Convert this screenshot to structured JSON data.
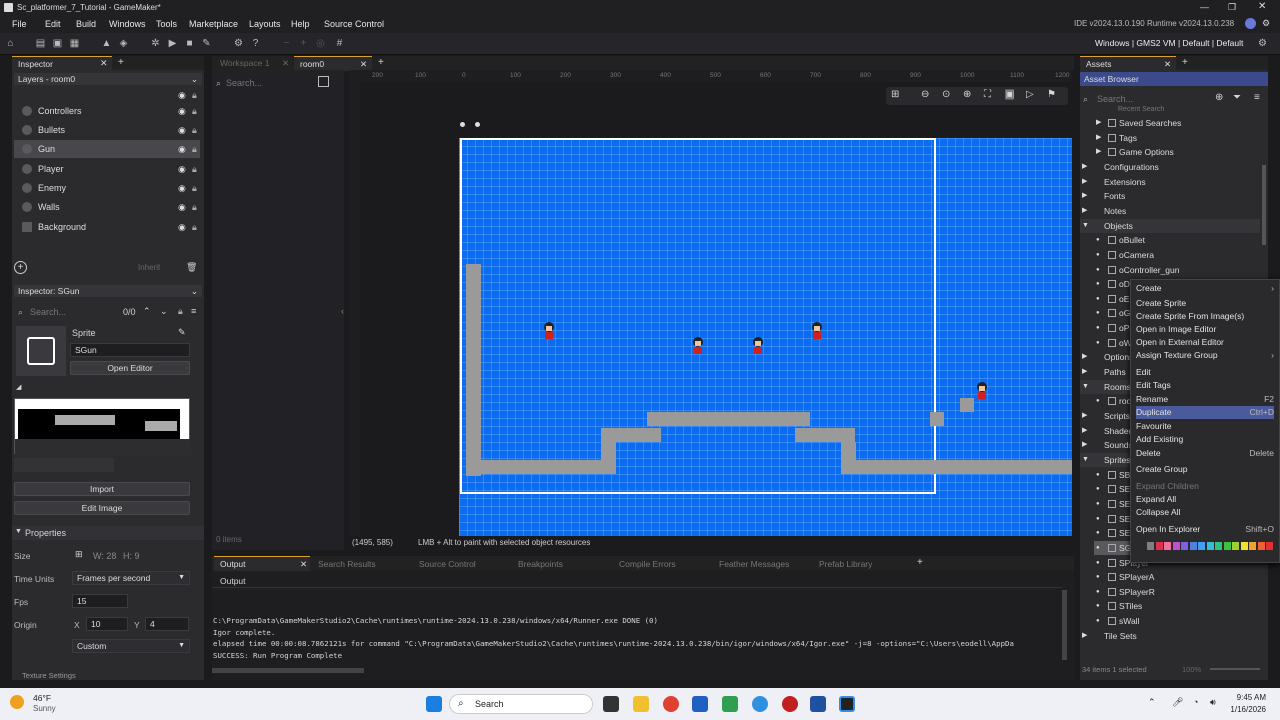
{
  "window": {
    "title": "Sc_platformer_7_Tutorial - GameMaker*",
    "ide_version": "IDE v2024.13.0.190  Runtime v2024.13.0.238"
  },
  "menu": [
    "File",
    "Edit",
    "Build",
    "Windows",
    "Tools",
    "Marketplace",
    "Layouts",
    "Help",
    "Source Control"
  ],
  "target": {
    "label": "Windows | GMS2 VM | Default | Default"
  },
  "inspector": {
    "tab": "Inspector",
    "layers_title": "Layers - room0",
    "layers": [
      "Controllers",
      "Bullets",
      "Gun",
      "Player",
      "Enemy",
      "Walls",
      "Background"
    ],
    "inherit": "Inherit",
    "sub_title": "Inspector: SGun",
    "search_placeholder": "Search...",
    "count": "0/0",
    "sprite_label": "Sprite",
    "sprite_name": "SGun",
    "open_editor": "Open Editor",
    "import": "Import",
    "edit_image": "Edit Image",
    "properties": "Properties",
    "size_label": "Size",
    "size_w": "W: 28",
    "size_h": "H: 9",
    "time_units_label": "Time Units",
    "time_units": "Frames per second",
    "fps_label": "Fps",
    "fps": "15",
    "origin_label": "Origin",
    "origin_x_label": "X",
    "origin_x": "10",
    "origin_y_label": "Y",
    "origin_y": "4",
    "origin_mode": "Custom",
    "texture_settings": "Texture Settings"
  },
  "workspace": {
    "tabs": [
      "Workspace 1",
      "room0"
    ],
    "search_placeholder": "Search...",
    "items_count": "0 items",
    "ruler_marks": [
      "200",
      "100",
      "0",
      "100",
      "200",
      "300",
      "400",
      "500",
      "600",
      "700",
      "800",
      "900",
      "1000",
      "1100",
      "1200"
    ],
    "status_coords": "(1495, 585)",
    "status_hint": "LMB + Alt to paint with selected object resources"
  },
  "output": {
    "tabs": [
      "Output",
      "Search Results",
      "Source Control",
      "Breakpoints",
      "Compile Errors",
      "Feather Messages",
      "Prefab Library"
    ],
    "heading": "Output",
    "lines": [
      "C:\\ProgramData\\GameMakerStudio2\\Cache\\runtimes\\runtime-2024.13.0.238/windows/x64/Runner.exe DONE (0)",
      "Igor complete.",
      "elapsed time 00:00:08.7862121s for command \"C:\\ProgramData\\GameMakerStudio2\\Cache\\runtimes\\runtime-2024.13.0.238/bin/igor/windows/x64/Igor.exe\" -j=8  -options=\"C:\\Users\\eodell\\AppDa",
      "SUCCESS: Run Program Complete"
    ]
  },
  "assets": {
    "tab": "Assets",
    "browser_title": "Asset Browser",
    "search_placeholder": "Search...",
    "partial_top": "Recent Search",
    "items": [
      {
        "label": "Saved Searches",
        "level": 1
      },
      {
        "label": "Tags",
        "level": 1
      },
      {
        "label": "Game Options",
        "level": 1
      },
      {
        "label": "Configurations",
        "level": 0
      },
      {
        "label": "Extensions",
        "level": 0
      },
      {
        "label": "Fonts",
        "level": 0
      },
      {
        "label": "Notes",
        "level": 0
      },
      {
        "label": "Objects",
        "level": 0
      },
      {
        "label": "oBullet",
        "level": 1
      },
      {
        "label": "oCamera",
        "level": 1
      },
      {
        "label": "oController_gun",
        "level": 1
      },
      {
        "label": "oDe",
        "level": 1
      },
      {
        "label": "oEn",
        "level": 1
      },
      {
        "label": "oGu",
        "level": 1
      },
      {
        "label": "oPla",
        "level": 1
      },
      {
        "label": "oWa",
        "level": 1
      },
      {
        "label": "Options",
        "level": 0
      },
      {
        "label": "Paths",
        "level": 0
      },
      {
        "label": "Rooms",
        "level": 0
      },
      {
        "label": "roo",
        "level": 1
      },
      {
        "label": "Scripts",
        "level": 0
      },
      {
        "label": "Shader",
        "level": 0
      },
      {
        "label": "Sounds",
        "level": 0
      },
      {
        "label": "Sprites",
        "level": 0
      },
      {
        "label": "SBu",
        "level": 1
      },
      {
        "label": "SEn",
        "level": 1
      },
      {
        "label": "SEn",
        "level": 1
      },
      {
        "label": "SEn",
        "level": 1
      },
      {
        "label": "SEn",
        "level": 1
      },
      {
        "label": "SGu",
        "level": 1
      },
      {
        "label": "SPlayer",
        "level": 1
      },
      {
        "label": "SPlayerA",
        "level": 1
      },
      {
        "label": "SPlayerR",
        "level": 1
      },
      {
        "label": "STiles",
        "level": 1
      },
      {
        "label": "sWall",
        "level": 1
      },
      {
        "label": "Tile Sets",
        "level": 0
      }
    ],
    "status": "34 items  1 selected",
    "zoom": "100%"
  },
  "context_menu": {
    "items": [
      {
        "label": "Create",
        "shortcut": ""
      },
      {
        "label": "Create Sprite",
        "shortcut": ""
      },
      {
        "label": "Create Sprite From Image(s)",
        "shortcut": ""
      },
      {
        "label": "Open in Image Editor",
        "shortcut": ""
      },
      {
        "label": "Open in External Editor",
        "shortcut": ""
      },
      {
        "label": "Assign Texture Group",
        "shortcut": ""
      },
      {
        "label": "Edit",
        "shortcut": ""
      },
      {
        "label": "Edit Tags",
        "shortcut": ""
      },
      {
        "label": "Rename",
        "shortcut": "F2"
      },
      {
        "label": "Duplicate",
        "shortcut": "Ctrl+D"
      },
      {
        "label": "Favourite",
        "shortcut": ""
      },
      {
        "label": "Add Existing",
        "shortcut": ""
      },
      {
        "label": "Delete",
        "shortcut": "Delete"
      },
      {
        "label": "Create Group",
        "shortcut": ""
      },
      {
        "label": "Expand Children",
        "shortcut": ""
      },
      {
        "label": "Expand All",
        "shortcut": ""
      },
      {
        "label": "Collapse All",
        "shortcut": ""
      },
      {
        "label": "Open In Explorer",
        "shortcut": "Shift+O"
      }
    ],
    "colors": [
      "#808080",
      "#e03050",
      "#f070a0",
      "#c050d0",
      "#8060e0",
      "#5080e0",
      "#40a0f0",
      "#30c0d0",
      "#30c080",
      "#40c040",
      "#a0d030",
      "#f0e030",
      "#f0a030",
      "#f06030",
      "#e03030"
    ]
  },
  "taskbar": {
    "weather_temp": "46°F",
    "weather_desc": "Sunny",
    "search": "Search",
    "time": "9:45 AM",
    "date": "1/16/2026"
  }
}
